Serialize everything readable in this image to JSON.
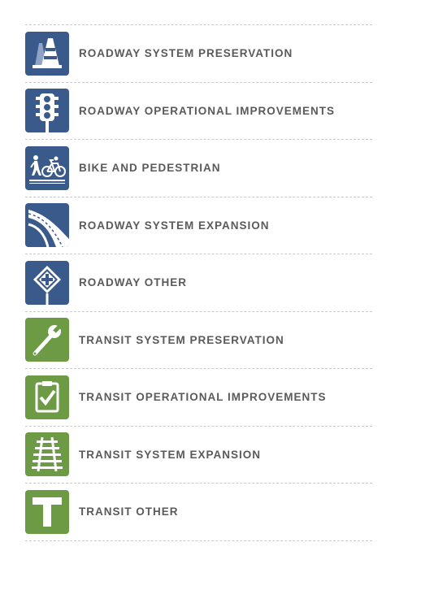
{
  "colors": {
    "roadway": "#3a5a8c",
    "transit": "#6d9a45",
    "label": "#5a5a5a",
    "divider": "#c9c9c9"
  },
  "legend": {
    "items": [
      {
        "label": "ROADWAY SYSTEM PRESERVATION",
        "icon": "traffic-cone-icon",
        "category": "roadway"
      },
      {
        "label": "ROADWAY OPERATIONAL IMPROVEMENTS",
        "icon": "traffic-light-icon",
        "category": "roadway"
      },
      {
        "label": "BIKE AND PEDESTRIAN",
        "icon": "pedestrian-bicycle-icon",
        "category": "roadway"
      },
      {
        "label": "ROADWAY SYSTEM EXPANSION",
        "icon": "curved-road-icon",
        "category": "roadway"
      },
      {
        "label": "ROADWAY OTHER",
        "icon": "intersection-sign-icon",
        "category": "roadway"
      },
      {
        "label": "TRANSIT SYSTEM PRESERVATION",
        "icon": "wrench-icon",
        "category": "transit"
      },
      {
        "label": "TRANSIT OPERATIONAL IMPROVEMENTS",
        "icon": "clipboard-check-icon",
        "category": "transit"
      },
      {
        "label": "TRANSIT SYSTEM EXPANSION",
        "icon": "rail-track-icon",
        "category": "transit"
      },
      {
        "label": "TRANSIT OTHER",
        "icon": "t-letter-icon",
        "category": "transit"
      }
    ]
  }
}
